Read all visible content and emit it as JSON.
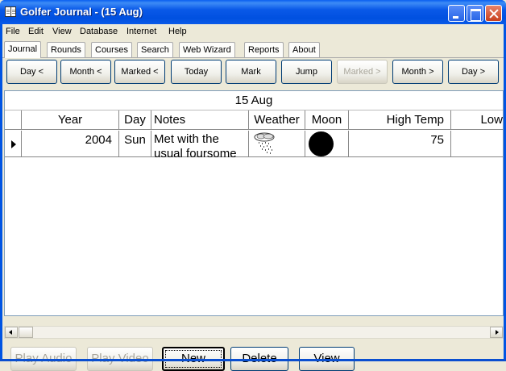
{
  "window": {
    "title": "Golfer Journal - (15 Aug)"
  },
  "menu": [
    "File",
    "Edit",
    "View",
    "Database",
    "Internet",
    "Help"
  ],
  "tabs": [
    "Journal",
    "Rounds",
    "Courses",
    "Search",
    "Web Wizard",
    "Reports",
    "About"
  ],
  "active_tab": "Journal",
  "nav_buttons": [
    {
      "label": "Day <",
      "enabled": true
    },
    {
      "label": "Month <",
      "enabled": true
    },
    {
      "label": "Marked <",
      "enabled": true
    },
    {
      "label": "Today",
      "enabled": true
    },
    {
      "label": "Mark",
      "enabled": true
    },
    {
      "label": "Jump",
      "enabled": true
    },
    {
      "label": "Marked >",
      "enabled": false
    },
    {
      "label": "Month >",
      "enabled": true
    },
    {
      "label": "Day >",
      "enabled": true
    }
  ],
  "grid": {
    "date_header": "15 Aug",
    "columns": [
      "Year",
      "Day",
      "Notes",
      "Weather",
      "Moon",
      "High Temp",
      "Low"
    ],
    "rows": [
      {
        "year": "2004",
        "day": "Sun",
        "notes": "Met with the usual foursome",
        "weather_icon": "rain-cloud-icon",
        "moon_icon": "new-moon-icon",
        "high_temp": "75"
      }
    ]
  },
  "action_buttons": [
    {
      "label": "Play Audio",
      "enabled": false
    },
    {
      "label": "Play Video",
      "enabled": false
    },
    {
      "label": "New",
      "enabled": true,
      "default": true
    },
    {
      "label": "Delete",
      "enabled": true
    },
    {
      "label": "View",
      "enabled": true
    }
  ],
  "colors": {
    "titlebar": "#0054e3",
    "face": "#ece9d8",
    "disabled_text": "#a9a69b"
  }
}
